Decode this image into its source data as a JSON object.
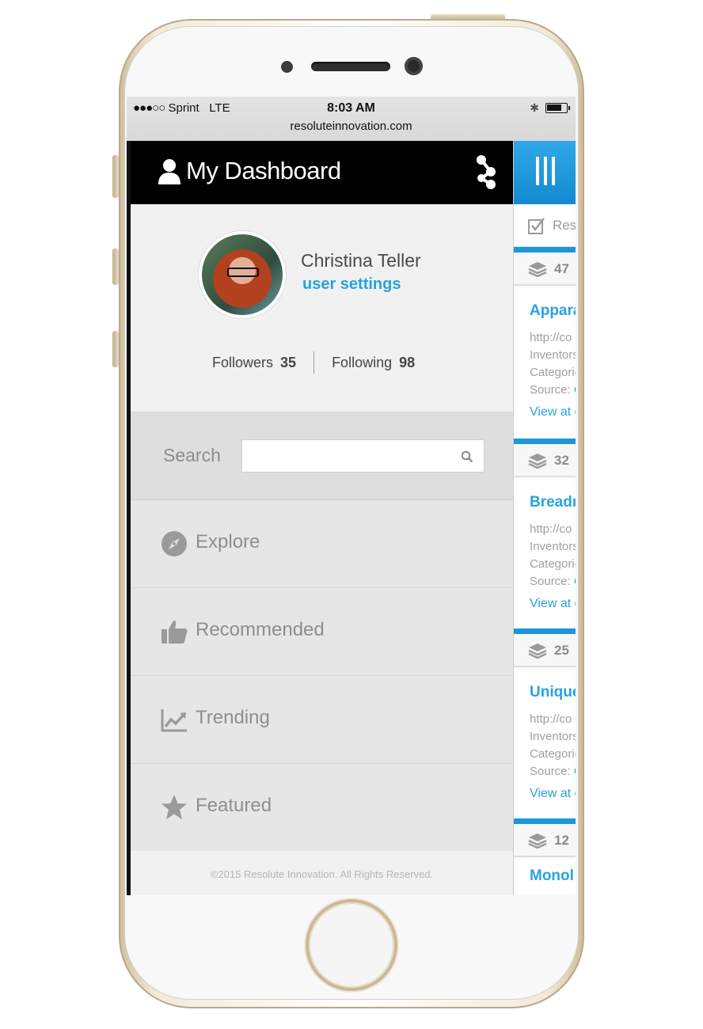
{
  "status_bar": {
    "carrier": "Sprint",
    "network": "LTE",
    "time": "8:03 AM",
    "url": "resoluteinnovation.com"
  },
  "topbar": {
    "title": "My Dashboard",
    "icons": [
      "user-icon",
      "share-icon"
    ]
  },
  "profile": {
    "name": "Christina Teller",
    "settings_link": "user settings",
    "followers_label": "Followers",
    "followers_count": "35",
    "following_label": "Following",
    "following_count": "98"
  },
  "search": {
    "label": "Search",
    "placeholder": "",
    "value": ""
  },
  "nav": [
    {
      "label": "Explore",
      "icon": "compass-icon"
    },
    {
      "label": "Recommended",
      "icon": "thumbs-up-icon"
    },
    {
      "label": "Trending",
      "icon": "trending-chart-icon"
    },
    {
      "label": "Featured",
      "icon": "star-icon"
    }
  ],
  "footer": {
    "text": "©2015 Resolute Innovation. All Rights Reserved."
  },
  "feed": {
    "check_text": "Res",
    "cards": [
      {
        "count": "47",
        "title": "Appara",
        "url": "http://co",
        "inventors": "Inventors",
        "categories": "Categorie",
        "source_label": "Source:",
        "source_value": "C",
        "view": "View at o"
      },
      {
        "count": "32",
        "title": "Breadn",
        "url": "http://co",
        "inventors": "Inventors",
        "categories": "Categorie",
        "source_label": "Source:",
        "source_value": "C",
        "view": "View at o"
      },
      {
        "count": "25",
        "title": "Unique",
        "url": "http://co",
        "inventors": "Inventors",
        "categories": "Categorie",
        "source_label": "Source:",
        "source_value": "C",
        "view": "View at o"
      },
      {
        "count": "12",
        "title": "Monol"
      }
    ]
  },
  "colors": {
    "accent": "#27a3e0",
    "topbar": "#000000",
    "menu_button": "#1e96d9"
  }
}
